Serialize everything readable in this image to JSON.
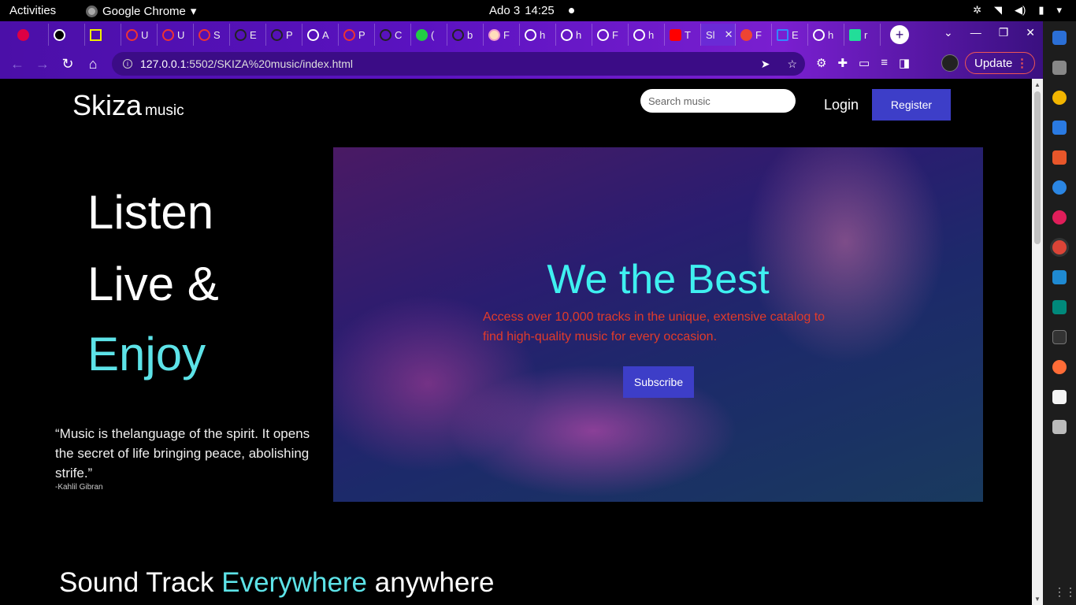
{
  "os": {
    "activities": "Activities",
    "app_name": "Google Chrome",
    "date": "Ado 3",
    "time": "14:25"
  },
  "browser": {
    "url_host": "127.0.0.1",
    "url_path": ":5502/SKIZA%20music/index.html",
    "update_label": "Update",
    "tabs": [
      {
        "label": ""
      },
      {
        "label": ""
      },
      {
        "label": ""
      },
      {
        "label": "U"
      },
      {
        "label": "U"
      },
      {
        "label": "S"
      },
      {
        "label": "E"
      },
      {
        "label": "P"
      },
      {
        "label": "A"
      },
      {
        "label": "P"
      },
      {
        "label": "C"
      },
      {
        "label": "("
      },
      {
        "label": "b"
      },
      {
        "label": "F"
      },
      {
        "label": "h"
      },
      {
        "label": "h"
      },
      {
        "label": "F"
      },
      {
        "label": "h"
      },
      {
        "label": "T"
      },
      {
        "label": "Sl"
      },
      {
        "label": "F"
      },
      {
        "label": "E"
      },
      {
        "label": "h"
      },
      {
        "label": "r"
      }
    ]
  },
  "site": {
    "logo_main": "Skiza",
    "logo_sub": "music",
    "search_placeholder": "Search music",
    "login": "Login",
    "register": "Register",
    "headline": [
      "Listen",
      "Live &",
      "Enjoy"
    ],
    "quote": "“Music is thelanguage of the spirit. It opens the secret of life bringing peace, abolishing strife.”",
    "quote_author": "-Kahlil Gibran",
    "hero": {
      "title": "We the Best",
      "text": "Access over 10,000 tracks in the unique, extensive catalog to find high-quality music for every occasion.",
      "subscribe": "Subscribe"
    },
    "section_title": {
      "part1": "Sound Track ",
      "accent": "Everywhere",
      "part2": " anywhere"
    }
  }
}
